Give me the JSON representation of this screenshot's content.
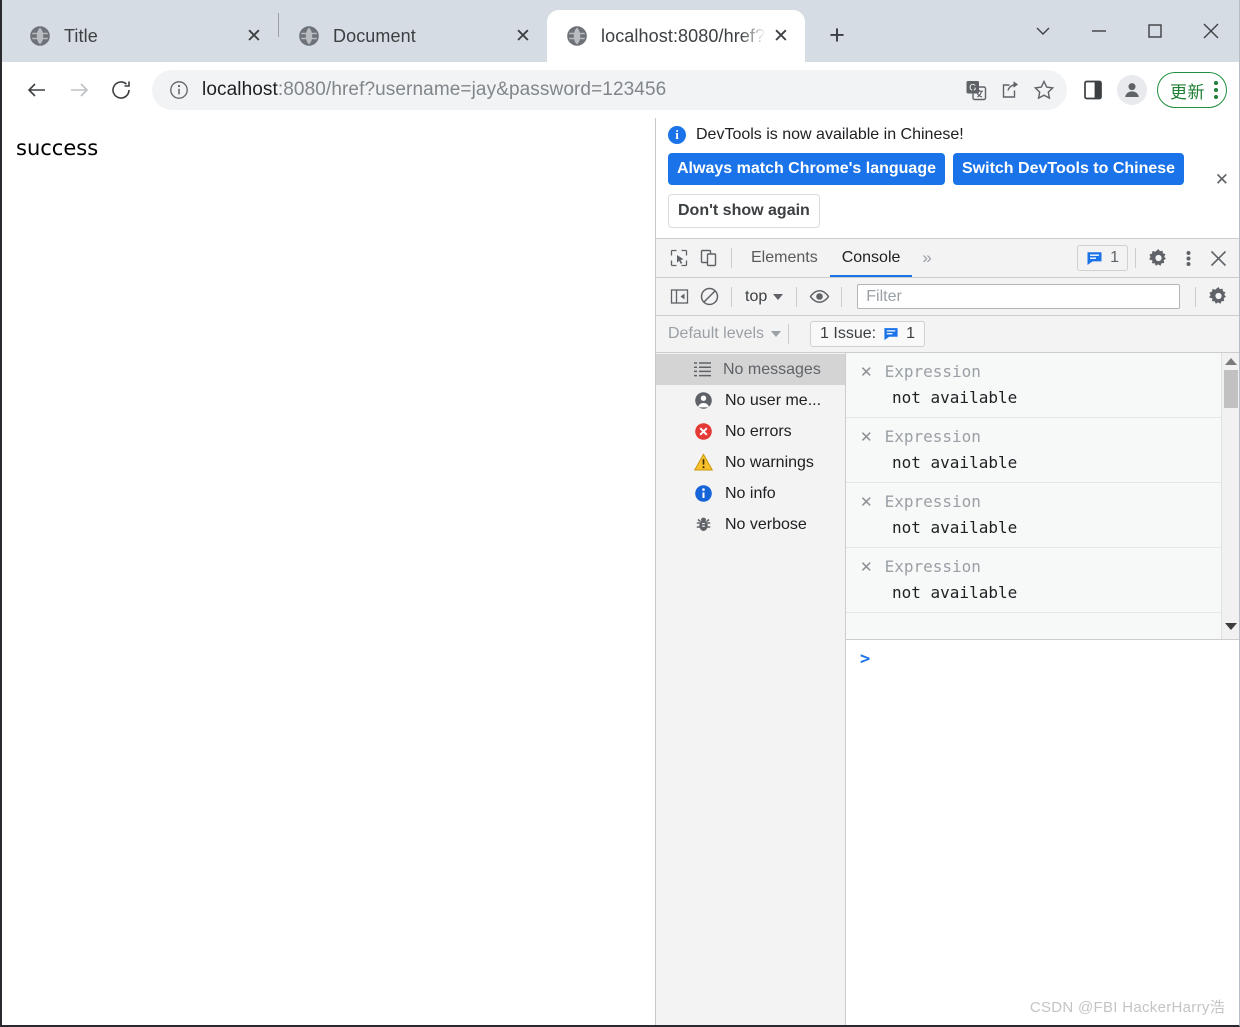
{
  "browser": {
    "tabs": [
      {
        "title": "Title",
        "favicon": "globe-icon",
        "active": false
      },
      {
        "title": "Document",
        "favicon": "globe-icon",
        "active": false
      },
      {
        "title": "localhost:8080/href?",
        "favicon": "globe-icon",
        "active": true
      }
    ],
    "new_tab_label": "+",
    "window_controls": {
      "tab_search": "chevron-down-icon",
      "minimize": "minimize-icon",
      "maximize": "maximize-icon",
      "close": "close-icon"
    }
  },
  "toolbar": {
    "back": "back-arrow-icon",
    "forward": "forward-arrow-icon",
    "reload": "reload-icon",
    "site_info": "info-circle-icon",
    "url_host": "localhost",
    "url_rest": ":8080/href?username=jay&password=123456",
    "url_full": "localhost:8080/href?username=jay&password=123456",
    "translate": "translate-icon",
    "share": "share-icon",
    "bookmark": "star-icon",
    "side_panel": "side-panel-icon",
    "profile": "avatar-icon",
    "update_label": "更新",
    "menu": "three-dots-icon"
  },
  "page": {
    "body_text": "success"
  },
  "devtools": {
    "banner": {
      "message": "DevTools is now available in Chinese!",
      "primary_button": "Always match Chrome's language",
      "secondary_button": "Switch DevTools to Chinese",
      "tertiary_button": "Don't show again",
      "close": "close-icon",
      "accent_color": "#1a73e8"
    },
    "tabbar": {
      "inspect": "inspect-cursor-icon",
      "device_toggle": "device-toolbar-icon",
      "tabs": [
        {
          "label": "Elements",
          "selected": false
        },
        {
          "label": "Console",
          "selected": true
        }
      ],
      "more_tabs": "»",
      "issues_count": "1",
      "issues_icon": "issue-bubble-icon",
      "settings": "gear-icon",
      "more_options": "three-dots-icon",
      "close": "close-icon",
      "active_tab_underline_color": "#1a73e8"
    },
    "console_toolbar": {
      "sidebar_toggle": "console-sidebar-toggle-icon",
      "clear_console": "clear-console-icon",
      "context": "top",
      "context_caret": "caret-down-icon",
      "live_expression": "eye-icon",
      "filter_placeholder": "Filter",
      "filter_value": "",
      "settings": "gear-icon"
    },
    "levels_bar": {
      "levels_label": "Default levels",
      "levels_caret": "caret-down-icon",
      "issue_label": "1 Issue:",
      "issue_icon": "issue-bubble-icon",
      "issue_count": "1"
    },
    "console_sidebar": [
      {
        "label": "No messages",
        "icon": "list-icon",
        "selected": true
      },
      {
        "label": "No user me...",
        "icon": "user-icon",
        "selected": false
      },
      {
        "label": "No errors",
        "icon": "error-circle-icon",
        "selected": false
      },
      {
        "label": "No warnings",
        "icon": "warning-triangle-icon",
        "selected": false
      },
      {
        "label": "No info",
        "icon": "info-circle-icon",
        "selected": false
      },
      {
        "label": "No verbose",
        "icon": "bug-icon",
        "selected": false
      }
    ],
    "live_expressions": [
      {
        "placeholder": "Expression",
        "value": "not available",
        "remove": "close-icon"
      },
      {
        "placeholder": "Expression",
        "value": "not available",
        "remove": "close-icon"
      },
      {
        "placeholder": "Expression",
        "value": "not available",
        "remove": "close-icon"
      },
      {
        "placeholder": "Expression",
        "value": "not available",
        "remove": "close-icon"
      }
    ],
    "prompt": ">"
  },
  "watermark": "CSDN @FBI HackerHarry浩"
}
